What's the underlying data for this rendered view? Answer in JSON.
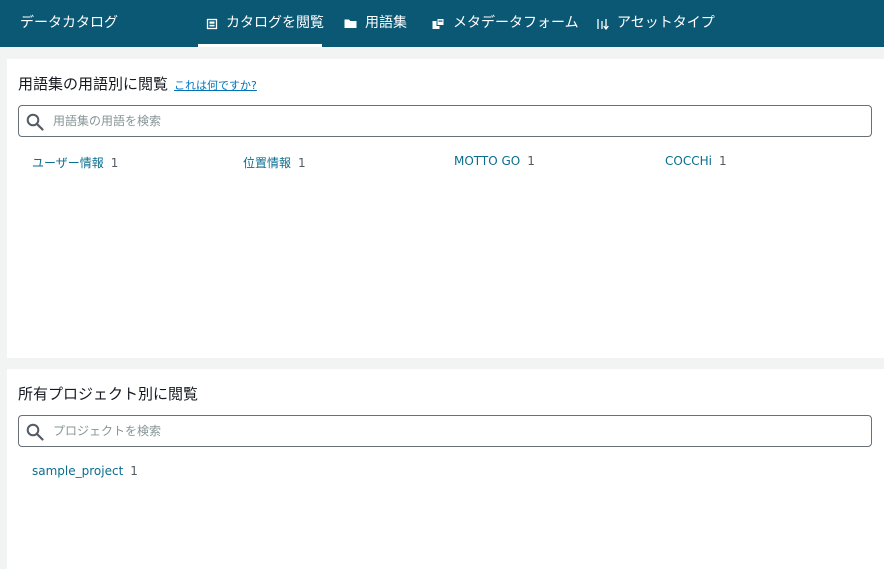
{
  "header": {
    "app_title": "データカタログ",
    "tabs": [
      {
        "label": "カタログを閲覧",
        "icon": "catalog-icon",
        "active": true
      },
      {
        "label": "用語集",
        "icon": "folder-icon",
        "active": false
      },
      {
        "label": "メタデータフォーム",
        "icon": "metadata-form-icon",
        "active": false
      },
      {
        "label": "アセットタイプ",
        "icon": "asset-type-icon",
        "active": false
      }
    ],
    "colors": {
      "background": "#0b5875",
      "text": "#ffffff"
    }
  },
  "glossary_section": {
    "title": "用語集の用語別に閲覧",
    "help_link": "これは何ですか?",
    "search_placeholder": "用語集の用語を検索",
    "terms": [
      {
        "label": "ユーザー情報",
        "count": "1"
      },
      {
        "label": "位置情報",
        "count": "1"
      },
      {
        "label": "MOTTO GO",
        "count": "1"
      },
      {
        "label": "COCCHi",
        "count": "1"
      }
    ]
  },
  "project_section": {
    "title": "所有プロジェクト別に閲覧",
    "search_placeholder": "プロジェクトを検索",
    "projects": [
      {
        "label": "sample_project",
        "count": "1"
      }
    ]
  },
  "colors": {
    "link": "#0b6e8f",
    "page_background": "#f2f3f3"
  }
}
